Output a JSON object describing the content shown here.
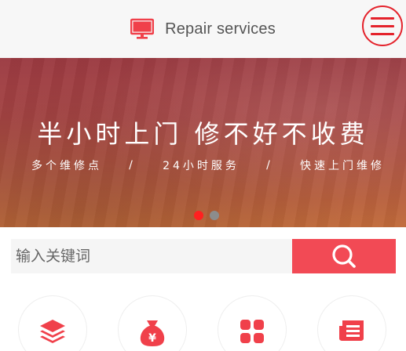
{
  "header": {
    "title": "Repair services",
    "brand_icon": "monitor-icon",
    "menu_icon": "hamburger-menu-icon",
    "accent_color": "#e4222b"
  },
  "banner": {
    "headline": "半小时上门 修不好不收费",
    "features": [
      "多个维修点",
      "/",
      "24小时服务",
      "/",
      "快速上门维修"
    ],
    "slide_count": 2,
    "active_slide": 1
  },
  "search": {
    "placeholder": "输入关键词",
    "button_icon": "search-icon",
    "button_color": "#f24a55"
  },
  "categories": [
    {
      "icon": "layers-icon"
    },
    {
      "icon": "money-bag-icon",
      "glyph": "¥"
    },
    {
      "icon": "grid-apps-icon"
    },
    {
      "icon": "news-list-icon"
    }
  ]
}
